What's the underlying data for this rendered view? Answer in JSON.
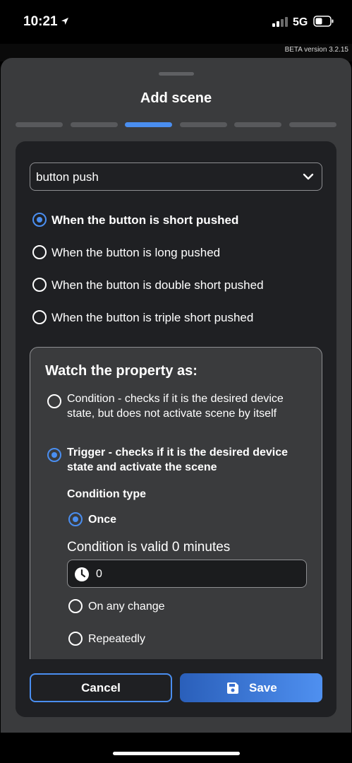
{
  "status_bar": {
    "time": "10:21",
    "network": "5G"
  },
  "beta_label": "BETA version 3.2.15",
  "title": "Add scene",
  "steps": {
    "count": 6,
    "active_index": 2
  },
  "event_select": {
    "value": "button push"
  },
  "push_options": [
    {
      "label": "When the button is short pushed",
      "selected": true
    },
    {
      "label": "When the button is long pushed",
      "selected": false
    },
    {
      "label": "When the button is double short pushed",
      "selected": false
    },
    {
      "label": "When the button is triple short pushed",
      "selected": false
    }
  ],
  "watch": {
    "title": "Watch the property as:",
    "condition_label": "Condition - checks if it is the desired device state, but does not activate scene by itself",
    "trigger_label": "Trigger - checks if it is the desired device state and activate the scene",
    "condition_type_label": "Condition type",
    "type_options": [
      {
        "label": "Once",
        "selected": true
      },
      {
        "label": "On any change",
        "selected": false
      },
      {
        "label": "Repeatedly",
        "selected": false
      }
    ],
    "valid_label": "Condition is valid 0 minutes",
    "minutes_value": "0"
  },
  "buttons": {
    "cancel": "Cancel",
    "save": "Save"
  },
  "colors": {
    "accent": "#4a8ef0",
    "sheet": "#3a3b3d",
    "card": "#1f2023"
  }
}
